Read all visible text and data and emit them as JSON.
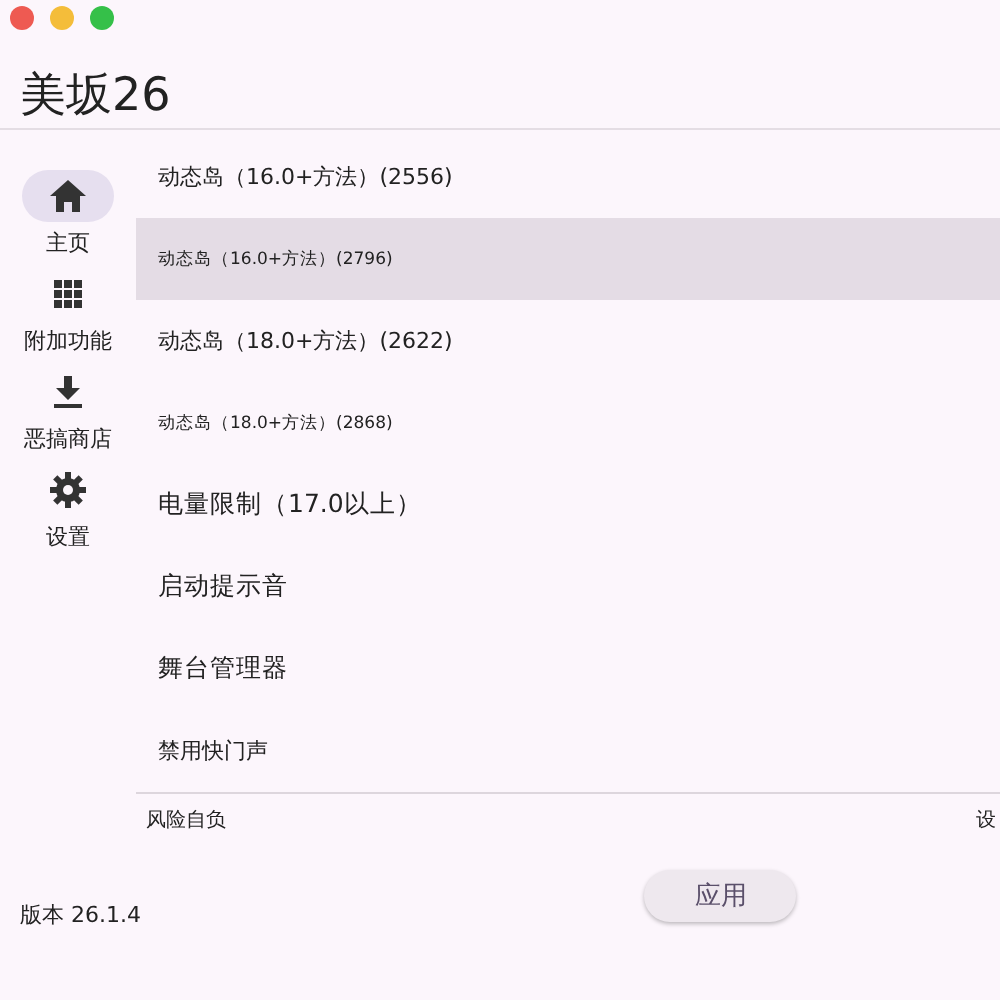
{
  "window": {
    "title": "美坂26"
  },
  "nav": [
    {
      "label": "主页",
      "selected": true
    },
    {
      "label": "附加功能",
      "selected": false
    },
    {
      "label": "恶搞商店",
      "selected": false
    },
    {
      "label": "设置",
      "selected": false
    }
  ],
  "items": [
    {
      "label": "动态岛（16.0+方法）(2556)",
      "kind": "medium",
      "selected": false
    },
    {
      "label": "动态岛（16.0+方法）(2796)",
      "kind": "small",
      "selected": true
    },
    {
      "label": "动态岛（18.0+方法）(2622)",
      "kind": "medium",
      "selected": false
    },
    {
      "label": "动态岛（18.0+方法）(2868)",
      "kind": "small",
      "selected": false
    },
    {
      "label": "电量限制（17.0以上）",
      "kind": "large",
      "selected": false
    },
    {
      "label": "启动提示音",
      "kind": "large",
      "selected": false
    },
    {
      "label": "舞台管理器",
      "kind": "large",
      "selected": false
    },
    {
      "label": "禁用快门声",
      "kind": "medium",
      "selected": false
    }
  ],
  "footer": {
    "left": "风险自负",
    "right": "设"
  },
  "version": "版本 26.1.4",
  "apply_button": "应用"
}
